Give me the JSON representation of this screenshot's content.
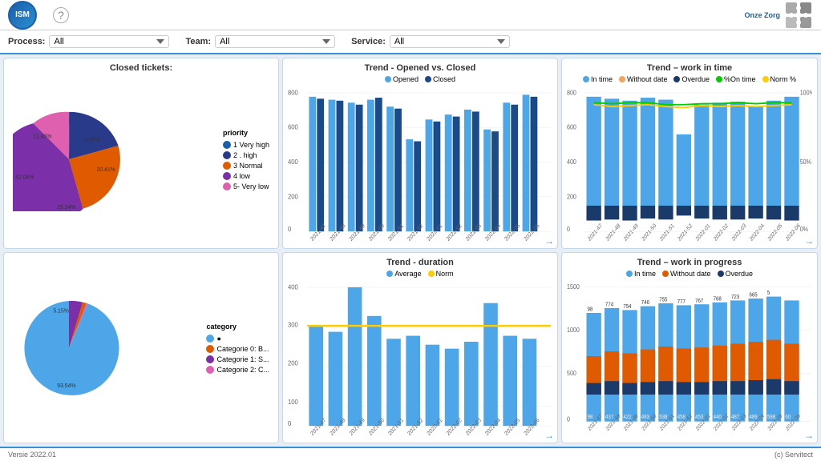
{
  "header": {
    "logo_text": "ISM",
    "help_label": "?",
    "brand_name": "Onze Zorg",
    "brand_sub": "(c) Servitect"
  },
  "filters": {
    "process_label": "Process:",
    "process_value": "All",
    "team_label": "Team:",
    "team_value": "All",
    "service_label": "Service:",
    "service_value": "All"
  },
  "charts": {
    "trend_opened_closed": {
      "title": "Trend - Opened vs. Closed",
      "legend": [
        {
          "label": "Opened",
          "color": "#4da6e8"
        },
        {
          "label": "Closed",
          "color": "#1a4a8a"
        }
      ],
      "y_labels": [
        "800",
        "600",
        "400",
        "200",
        "0"
      ],
      "x_labels": [
        "2021-47",
        "2021-48",
        "2021-49",
        "2021-50",
        "2021-51",
        "2021-52",
        "2022-01",
        "2022-02",
        "2022-03",
        "2022-04",
        "2022-05",
        "2022-06"
      ],
      "data": [
        [
          720,
          690
        ],
        [
          700,
          680
        ],
        [
          680,
          660
        ],
        [
          700,
          710
        ],
        [
          650,
          640
        ],
        [
          500,
          490
        ],
        [
          620,
          610
        ],
        [
          640,
          630
        ],
        [
          660,
          650
        ],
        [
          550,
          540
        ],
        [
          680,
          670
        ],
        [
          730,
          720
        ]
      ]
    },
    "trend_work_time": {
      "title": "Trend – work in time",
      "legend": [
        {
          "label": "In time",
          "color": "#4da6e8"
        },
        {
          "label": "Without date",
          "color": "#f4a460"
        },
        {
          "label": "Overdue",
          "color": "#1a3a6a"
        },
        {
          "label": "% On time",
          "color": "#00cc00"
        },
        {
          "label": "Norm %",
          "color": "#ffcc00"
        }
      ],
      "y_labels": [
        "800",
        "600",
        "400",
        "200",
        "0"
      ],
      "y2_labels": [
        "100%",
        "50%",
        "0%"
      ],
      "x_labels": [
        "2021-47",
        "2021-48",
        "2021-49",
        "2021-50",
        "2021-51",
        "2021-52",
        "2022-01",
        "2022-02",
        "2022-03",
        "2022-04",
        "2022-05",
        "2022-06"
      ]
    },
    "closed_tickets": {
      "title": "Closed tickets:",
      "priority_title": "priority",
      "segments": [
        {
          "label": "1  Very high",
          "color": "#1a5fa8",
          "value": 0.08,
          "pct": "0.08%"
        },
        {
          "label": "2 . high",
          "color": "#2a3a8a",
          "value": 20.41,
          "pct": "20.41%"
        },
        {
          "label": "3  Normal",
          "color": "#e05a00",
          "value": 25.24,
          "pct": "25.24%"
        },
        {
          "label": "4  low",
          "color": "#7b2fa8",
          "value": 42.08,
          "pct": "42.08%"
        },
        {
          "label": "5-  Very low",
          "color": "#e060b0",
          "value": 11.43,
          "pct": "11.43%"
        }
      ]
    },
    "trend_duration": {
      "title": "Trend - duration",
      "legend": [
        {
          "label": "Average",
          "color": "#4da6e8"
        },
        {
          "label": "Norm",
          "color": "#ffcc00"
        }
      ],
      "y_labels": [
        "400",
        "300",
        "200",
        "100",
        "0"
      ],
      "x_labels": [
        "2021-47",
        "2021-48",
        "2021-49",
        "2021-50",
        "2021-51",
        "2021-52",
        "2022-01",
        "2022-02",
        "2022-03",
        "2022-04",
        "2022-05",
        "2022-06"
      ],
      "data": [
        310,
        290,
        430,
        340,
        270,
        280,
        250,
        240,
        260,
        380,
        280,
        270
      ],
      "norm": 310
    },
    "trend_work_progress": {
      "title": "Trend – work in progress",
      "legend": [
        {
          "label": "In time",
          "color": "#4da6e8"
        },
        {
          "label": "Without date",
          "color": "#e05a00"
        },
        {
          "label": "Overdue",
          "color": "#1a3a6a"
        }
      ],
      "x_labels": [
        "2021-47",
        "2021-48",
        "2021-49",
        "2021-50",
        "2021-51",
        "2021-52",
        "2022-01",
        "2022-02",
        "2022-03",
        "2022-04",
        "2022-05",
        "2022-06"
      ],
      "labels_top": [
        "",
        "774",
        "754",
        "746",
        "755",
        "777",
        "767",
        "768",
        "723",
        "665",
        "5",
        ""
      ],
      "labels_bot": [
        "98",
        "437",
        "422",
        "483",
        "538",
        "458",
        "453",
        "440",
        "487",
        "489",
        "598",
        "60"
      ]
    },
    "category": {
      "title": "category",
      "segments": [
        {
          "label": "●",
          "color": "#4da6e8",
          "value": 93.54,
          "pct": "93.54%"
        },
        {
          "label": "Categorie 0: B...",
          "color": "#e05a00",
          "value": 1.31,
          "pct": ""
        },
        {
          "label": "Categorie 1: S...",
          "color": "#7b2fa8",
          "value": 5.15,
          "pct": "5.15%"
        },
        {
          "label": "Categorie 2: C...",
          "color": "#e060b0",
          "value": 0.5,
          "pct": ""
        }
      ]
    }
  },
  "footer": {
    "version": "Versie 2022.01",
    "copyright": "(c) Servitect"
  }
}
